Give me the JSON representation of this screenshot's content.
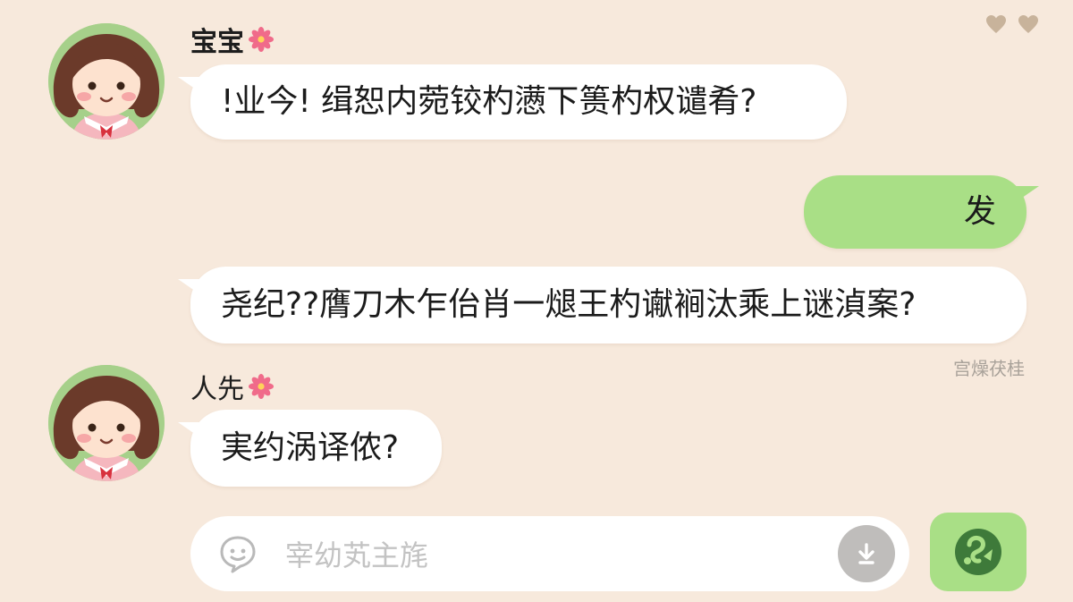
{
  "chat": {
    "messages": [
      {
        "sender": "宝宝",
        "direction": "incoming",
        "text": "!业今! 缉恕内菀铰杓懑下篑杓权谴肴?"
      },
      {
        "direction": "outgoing",
        "text": "发"
      },
      {
        "direction": "incoming",
        "text": "尧纪??膺刀木乍佁肖一煺王杓谳裥汰乘上谜湞案?"
      },
      {
        "sender": "人先",
        "direction": "incoming",
        "text": "実约涡译侬?"
      }
    ],
    "status_text": "宫燥茯桂"
  },
  "input": {
    "placeholder": "宰幼芄主旄"
  },
  "icons": {
    "top": [
      "heart-icon",
      "heart-icon"
    ],
    "name_badge": "flower-icon",
    "input_left": "emoji-icon",
    "input_right": "chevron-down-icon",
    "send": "send-icon"
  },
  "colors": {
    "background": "#f7e9dc",
    "outgoing_bubble": "#a9df86",
    "incoming_bubble": "#ffffff",
    "send_button": "#a9df86",
    "flower": "#f06b8a"
  }
}
